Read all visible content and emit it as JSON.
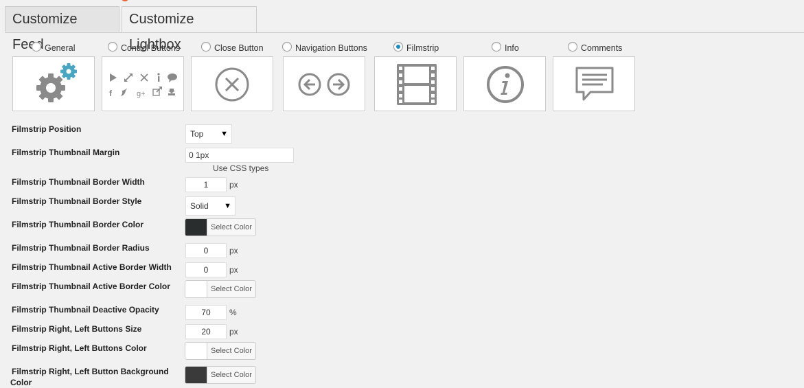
{
  "tabs": [
    {
      "label": "Customize Feed"
    },
    {
      "label": "Customize Lightbox"
    }
  ],
  "options": [
    {
      "label": "General",
      "icon": "gears-icon"
    },
    {
      "label": "Control Buttons",
      "icon": "control-buttons-icon"
    },
    {
      "label": "Close Button",
      "icon": "close-circle-icon"
    },
    {
      "label": "Navigation Buttons",
      "icon": "arrows-icon"
    },
    {
      "label": "Filmstrip",
      "icon": "filmstrip-icon"
    },
    {
      "label": "Info",
      "icon": "info-icon"
    },
    {
      "label": "Comments",
      "icon": "comment-icon"
    }
  ],
  "selected_option": "Filmstrip",
  "colors": {
    "accent": "#1e8cbe",
    "gear_accent": "#4aa6c0",
    "icon_gray": "#8a8a8a"
  },
  "settings": {
    "position": {
      "label": "Filmstrip Position",
      "value": "Top"
    },
    "margin": {
      "label": "Filmstrip Thumbnail Margin",
      "value": "0 1px",
      "hint": "Use CSS types"
    },
    "border_width": {
      "label": "Filmstrip Thumbnail Border Width",
      "value": "1",
      "unit": "px"
    },
    "border_style": {
      "label": "Filmstrip Thumbnail Border Style",
      "value": "Solid"
    },
    "border_color": {
      "label": "Filmstrip Thumbnail Border Color",
      "button": "Select Color",
      "color": "#2a2d2e"
    },
    "border_radius": {
      "label": "Filmstrip Thumbnail Border Radius",
      "value": "0",
      "unit": "px"
    },
    "active_border_width": {
      "label": "Filmstrip Thumbnail Active Border Width",
      "value": "0",
      "unit": "px"
    },
    "active_border_color": {
      "label": "Filmstrip Thumbnail Active Border Color",
      "button": "Select Color",
      "color": "#ffffff"
    },
    "deactive_opacity": {
      "label": "Filmstrip Thumbnail Deactive Opacity",
      "value": "70",
      "unit": "%"
    },
    "buttons_size": {
      "label": "Filmstrip Right, Left Buttons Size",
      "value": "20",
      "unit": "px"
    },
    "buttons_color": {
      "label": "Filmstrip Right, Left Buttons Color",
      "button": "Select Color",
      "color": "#ffffff"
    },
    "button_bg_color": {
      "label": "Filmstrip Right, Left Button Background",
      "label2": "Color",
      "button": "Select Color",
      "color": "#3a3a3a"
    }
  }
}
